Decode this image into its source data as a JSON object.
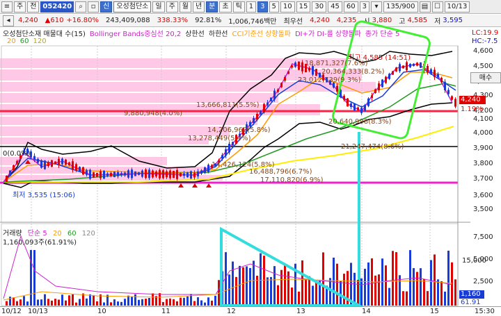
{
  "toolbar": {
    "items": [
      "주",
      "전",
      "일",
      "주",
      "월",
      "년",
      "분",
      "초",
      "틱",
      "1",
      "3",
      "5",
      "10",
      "15",
      "30",
      "45",
      "60",
      "3"
    ],
    "code": "052420",
    "badge": "신",
    "stock_name": "오성첨단소",
    "interval_value": "3",
    "count": "135/900",
    "date_tab": "10/13"
  },
  "quote": {
    "price": "4,240",
    "change": "610",
    "change_pct": "+16.80%",
    "volume": "243,409,088",
    "vol_ratio": "338.33%",
    "strength": "92.81%",
    "amount": "1,006,746백만",
    "pref_label": "최우선",
    "ask": "4,240",
    "bid": "4,235",
    "high_label": "시",
    "open": "3,880",
    "high2_label": "고",
    "high": "4,585",
    "low_label": "저",
    "low": "3,595"
  },
  "legend": {
    "title": "오성첨단소재 매물대 수(15)",
    "bollinger": "Bollinger Bands중심선 20,2",
    "upper": "상한선",
    "lower": "하한선",
    "cci": "CCI기준선 상향돌파",
    "di": "DI+가 DI-를 상향돌파",
    "ma": "종가 단순 5",
    "ma_periods": [
      "20",
      "60",
      "120"
    ],
    "right_top": "LC:19.9",
    "right_bottom": "HC:-7.5"
  },
  "price_axis": [
    "4,600",
    "4,500",
    "4,400",
    "4,300",
    "4,200",
    "4,100",
    "4,000",
    "3,900",
    "3,800",
    "3,700",
    "3,600",
    "3,500"
  ],
  "price_tag": "4,240",
  "price_tag_pct": "1.19%",
  "side_button": "매수",
  "annotations": {
    "high": "최고 4,585 (14:51)",
    "low": "최저 3,535 (15:06)",
    "zero": "0(0.0%)",
    "v1": "18,871,327(7.6%)",
    "v2": "20,364,333(8.2%)",
    "v3": "23,012,739(9.3%)",
    "v4": "13,666,811(5.5%)",
    "v5": "9,880,948(4.0%)",
    "v6": "14,206,960(5.8%)",
    "v7": "13,278,449(5.4%)",
    "v8": "20,640,998(8.3%)",
    "v9": "21,247,474(8.6%)",
    "v10": "14,426,124(5.8%)",
    "v11": "16,488,796(6.7%)",
    "v12": "17,110,820(6.9%)"
  },
  "volume": {
    "label": "거래량",
    "ma_label": "단순 5",
    "ma_periods": [
      "20",
      "60",
      "120"
    ],
    "value": "1,160,093주(61.91%)",
    "axis": [
      "7,500",
      "5,000",
      "2,500"
    ],
    "axis_unit": "15,000",
    "tag": "1,160",
    "tag_pct": "61.91"
  },
  "time_axis": [
    "10/12",
    "10/13",
    "10",
    "11",
    "12",
    "13",
    "14",
    "15",
    "15:30"
  ],
  "colors": {
    "up": "#e00000",
    "down": "#1a3cd6",
    "band": "#ffc8e6",
    "highlight_green": "#44ee33",
    "highlight_cyan": "#33dddd",
    "ma5": "#d020d0",
    "ma20": "#ff9900",
    "ma60": "#229922",
    "ma120": "#ffee00"
  },
  "chart_data": {
    "type": "candlestick",
    "price_levels": [
      3535,
      3600,
      3620,
      3700,
      3800,
      3880,
      3900,
      4100,
      4130,
      4200,
      4240,
      4585
    ],
    "x": [
      "10",
      "11",
      "12",
      "13",
      "14",
      "15"
    ],
    "key_prices": {
      "open": 3880,
      "high": 4585,
      "low": 3595,
      "last": 4240
    }
  }
}
